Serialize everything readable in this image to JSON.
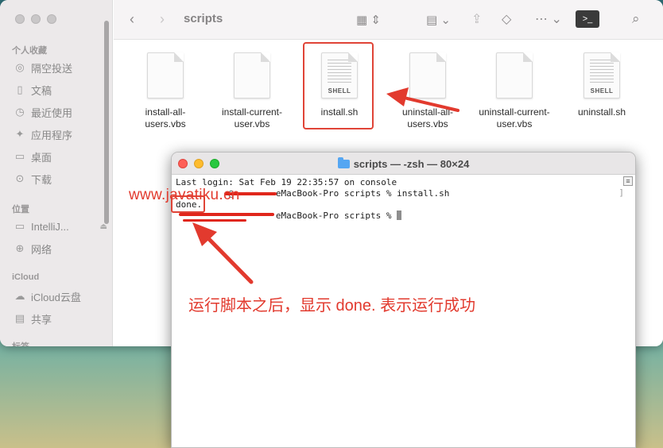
{
  "finder": {
    "title": "scripts",
    "sidebar": {
      "favorites_header": "个人收藏",
      "favorites": [
        {
          "label": "隔空投送",
          "icon": "airdrop-icon"
        },
        {
          "label": "文稿",
          "icon": "document-icon"
        },
        {
          "label": "最近使用",
          "icon": "clock-icon"
        },
        {
          "label": "应用程序",
          "icon": "applications-icon"
        },
        {
          "label": "桌面",
          "icon": "desktop-icon"
        },
        {
          "label": "下载",
          "icon": "download-icon"
        }
      ],
      "locations_header": "位置",
      "locations": [
        {
          "label": "IntelliJ...",
          "icon": "disk-icon"
        },
        {
          "label": "网络",
          "icon": "network-icon"
        }
      ],
      "icloud_header": "iCloud",
      "icloud": [
        {
          "label": "iCloud云盘",
          "icon": "cloud-icon"
        },
        {
          "label": "共享",
          "icon": "shared-folder-icon"
        }
      ],
      "tags_header_partial": "标签"
    },
    "files": [
      {
        "name_line1": "install-all-",
        "name_line2": "users.vbs",
        "kind": "blank"
      },
      {
        "name_line1": "install-current-",
        "name_line2": "user.vbs",
        "kind": "blank"
      },
      {
        "name_line1": "install.sh",
        "name_line2": "",
        "kind": "shell",
        "badge": "SHELL",
        "selected": true
      },
      {
        "name_line1": "uninstall-all-",
        "name_line2": "users.vbs",
        "kind": "blank"
      },
      {
        "name_line1": "uninstall-current-",
        "name_line2": "user.vbs",
        "kind": "blank"
      },
      {
        "name_line1": "uninstall.sh",
        "name_line2": "",
        "kind": "shell",
        "badge": "SHELL"
      }
    ]
  },
  "terminal": {
    "title": "scripts — -zsh — 80×24",
    "lines": [
      "Last login: Sat Feb 19 22:35:57 on console",
      "          @        eMacBook-Pro scripts % install.sh",
      "done.",
      "                   eMacBook-Pro scripts % "
    ]
  },
  "annotations": {
    "watermark": "www.javatiku.cn",
    "caption": "运行脚本之后，显示 done. 表示运行成功",
    "accent_color": "#e23a2e"
  }
}
